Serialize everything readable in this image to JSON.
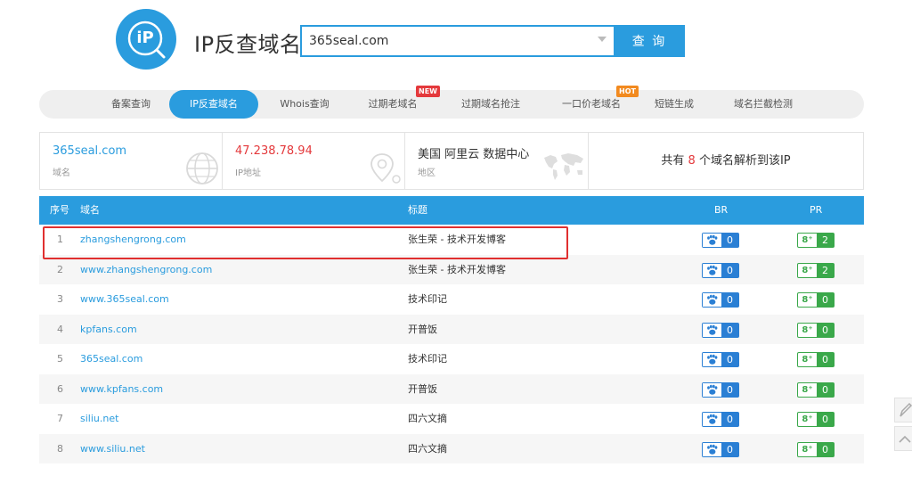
{
  "header": {
    "logo_text": "iP",
    "title": "IP反查域名",
    "search": {
      "value": "365seal.com",
      "button_label": "查 询"
    }
  },
  "nav": {
    "items": [
      {
        "label": "备案查询",
        "active": false
      },
      {
        "label": "IP反查域名",
        "active": true
      },
      {
        "label": "Whois查询",
        "active": false
      },
      {
        "label": "过期老域名",
        "active": false,
        "badge": "NEW"
      },
      {
        "label": "过期域名抢注",
        "active": false
      },
      {
        "label": "一口价老域名",
        "active": false,
        "badge": "HOT"
      },
      {
        "label": "短链生成",
        "active": false
      },
      {
        "label": "域名拦截检测",
        "active": false
      }
    ]
  },
  "info": {
    "domain": {
      "value": "365seal.com",
      "label": "域名",
      "icon": "globe-icon"
    },
    "ip": {
      "value": "47.238.78.94",
      "label": "IP地址",
      "icon": "location-pin-icon"
    },
    "region": {
      "value": "美国 阿里云 数据中心",
      "label": "地区",
      "icon": "world-map-icon"
    },
    "summary": {
      "prefix": "共有",
      "count": "8",
      "suffix": "个域名解析到该IP"
    }
  },
  "table": {
    "headers": {
      "num": "序号",
      "domain": "域名",
      "title": "标题",
      "br": "BR",
      "pr": "PR"
    },
    "rows": [
      {
        "num": "1",
        "domain": "zhangshengrong.com",
        "title": "张生荣 - 技术开发博客",
        "br": "0",
        "pr": "2"
      },
      {
        "num": "2",
        "domain": "www.zhangshengrong.com",
        "title": "张生荣 - 技术开发博客",
        "br": "0",
        "pr": "2"
      },
      {
        "num": "3",
        "domain": "www.365seal.com",
        "title": "技术印记",
        "br": "0",
        "pr": "0"
      },
      {
        "num": "4",
        "domain": "kpfans.com",
        "title": "开普饭",
        "br": "0",
        "pr": "0"
      },
      {
        "num": "5",
        "domain": "365seal.com",
        "title": "技术印记",
        "br": "0",
        "pr": "0"
      },
      {
        "num": "6",
        "domain": "www.kpfans.com",
        "title": "开普饭",
        "br": "0",
        "pr": "0"
      },
      {
        "num": "7",
        "domain": "siliu.net",
        "title": "四六文摘",
        "br": "0",
        "pr": "0"
      },
      {
        "num": "8",
        "domain": "www.siliu.net",
        "title": "四六文摘",
        "br": "0",
        "pr": "0"
      }
    ],
    "br_icon": "paw-icon",
    "pr_icon_text": "8⁺"
  },
  "colors": {
    "accent": "#2a9cde",
    "ip_red": "#e4393c",
    "highlight_red": "#e02f2f",
    "br_blue": "#2a7fd4",
    "pr_green": "#3aa84a",
    "badge_new": "#e4393c",
    "badge_hot": "#f28a1f"
  },
  "side_tools": [
    "pencil-icon",
    "chevron-up-icon"
  ]
}
